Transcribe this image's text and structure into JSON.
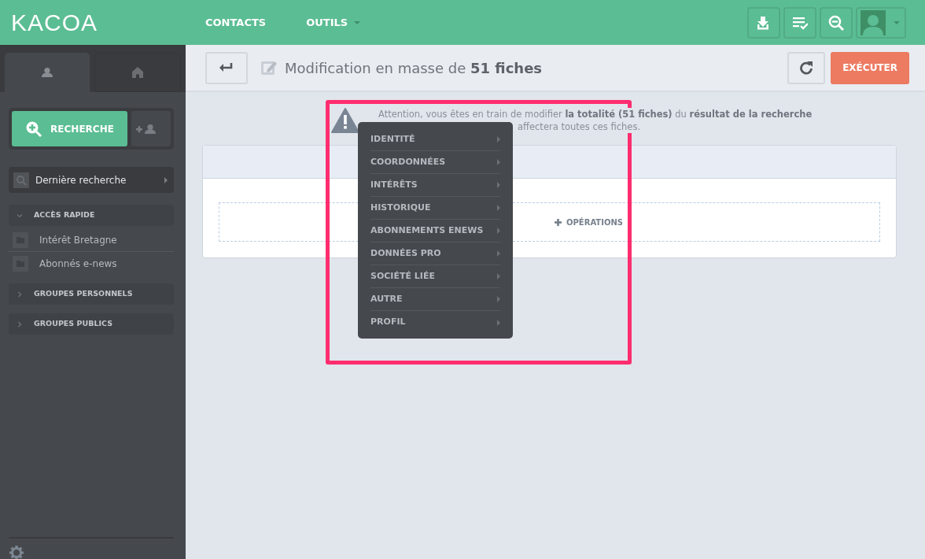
{
  "navbar": {
    "logo": "KACOA",
    "items": [
      {
        "label": "CONTACTS",
        "dropdown": false
      },
      {
        "label": "OUTILS",
        "dropdown": true
      }
    ]
  },
  "sidebar": {
    "tabs": [
      {
        "kind": "person",
        "selected": true
      },
      {
        "kind": "home",
        "selected": false
      }
    ],
    "search_button": "RECHERCHE",
    "last_search": "Dernière recherche",
    "sections": [
      {
        "label": "ACCÈS RAPIDE",
        "expanded": true,
        "children": [
          {
            "label": "Intérêt Bretagne"
          },
          {
            "label": "Abonnés e-news"
          }
        ]
      },
      {
        "label": "GROUPES PERSONNELS",
        "expanded": false
      },
      {
        "label": "GROUPES PUBLICS",
        "expanded": false
      }
    ]
  },
  "toolbar": {
    "title": "Modification en masse de **51 fiches**",
    "execute_button": "EXÉCUTER"
  },
  "warning": {
    "line_1": "Attention, vous êtes en train de modifier **la totalité (51 fiches)** du **résultat de la recherche**",
    "line_2": "affectera toutes ces fiches."
  },
  "operations": {
    "label": "OPÉRATIONS"
  },
  "menu": {
    "items": [
      {
        "label": "IDENTITÉ"
      },
      {
        "label": "COORDONNÉES"
      },
      {
        "label": "INTÉRÊTS"
      },
      {
        "label": "HISTORIQUE"
      },
      {
        "label": "ABONNEMENTS ENEWS"
      },
      {
        "label": "DONNÉES PRO"
      },
      {
        "label": "SOCIÉTÉ LIÉE"
      },
      {
        "label": "AUTRE"
      },
      {
        "label": "PROFIL"
      }
    ]
  }
}
